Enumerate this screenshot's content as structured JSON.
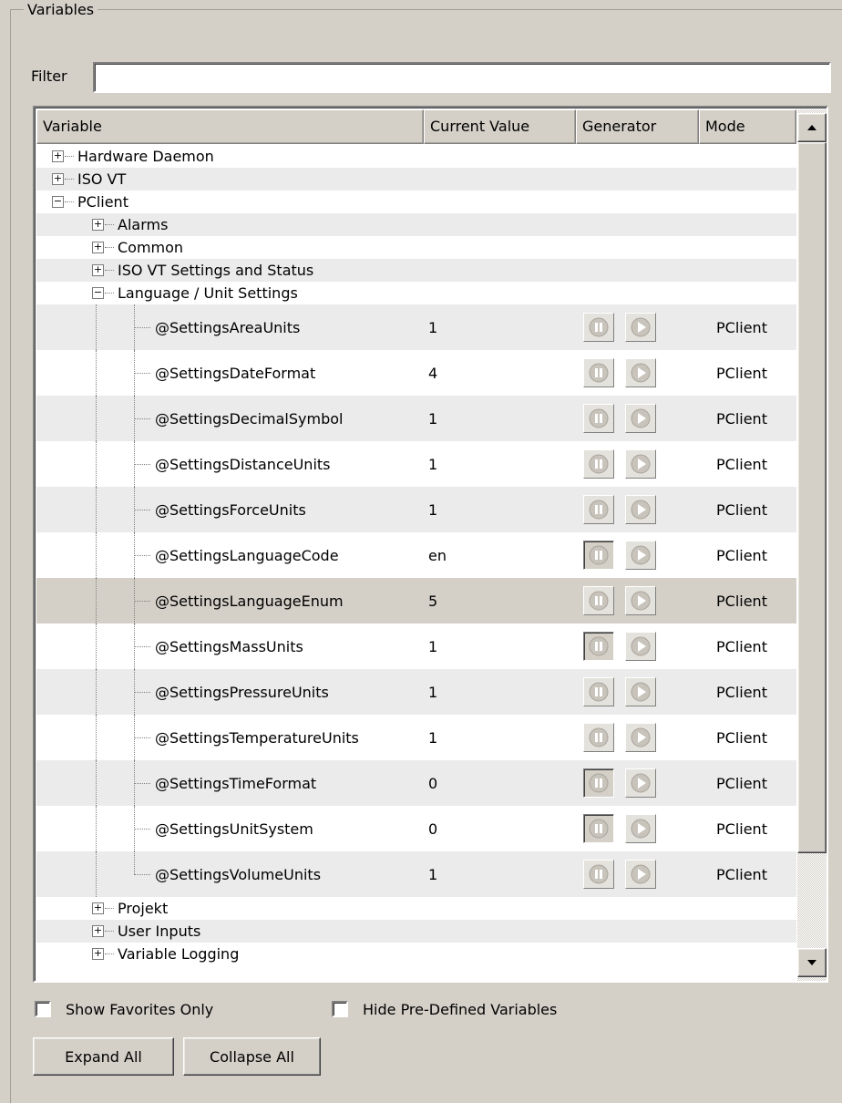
{
  "groupbox_title": "Variables",
  "filter": {
    "label": "Filter",
    "value": ""
  },
  "columns": [
    "Variable",
    "Current Value",
    "Generator",
    "Mode"
  ],
  "tree_top": [
    {
      "label": "Hardware Daemon",
      "expander": "+"
    },
    {
      "label": "ISO VT",
      "expander": "+"
    },
    {
      "label": "PClient",
      "expander": "−"
    }
  ],
  "pclient_children": [
    {
      "label": "Alarms",
      "expander": "+"
    },
    {
      "label": "Common",
      "expander": "+"
    },
    {
      "label": "ISO VT Settings and Status",
      "expander": "+"
    },
    {
      "label": "Language / Unit Settings",
      "expander": "−"
    }
  ],
  "variables": [
    {
      "name": "@SettingsAreaUnits",
      "value": "1",
      "mode": "PClient",
      "pause_pressed": false
    },
    {
      "name": "@SettingsDateFormat",
      "value": "4",
      "mode": "PClient",
      "pause_pressed": false
    },
    {
      "name": "@SettingsDecimalSymbol",
      "value": "1",
      "mode": "PClient",
      "pause_pressed": false
    },
    {
      "name": "@SettingsDistanceUnits",
      "value": "1",
      "mode": "PClient",
      "pause_pressed": false
    },
    {
      "name": "@SettingsForceUnits",
      "value": "1",
      "mode": "PClient",
      "pause_pressed": false
    },
    {
      "name": "@SettingsLanguageCode",
      "value": "en",
      "mode": "PClient",
      "pause_pressed": true
    },
    {
      "name": "@SettingsLanguageEnum",
      "value": "5",
      "mode": "PClient",
      "pause_pressed": false,
      "selected": true
    },
    {
      "name": "@SettingsMassUnits",
      "value": "1",
      "mode": "PClient",
      "pause_pressed": true
    },
    {
      "name": "@SettingsPressureUnits",
      "value": "1",
      "mode": "PClient",
      "pause_pressed": false
    },
    {
      "name": "@SettingsTemperatureUnits",
      "value": "1",
      "mode": "PClient",
      "pause_pressed": false
    },
    {
      "name": "@SettingsTimeFormat",
      "value": "0",
      "mode": "PClient",
      "pause_pressed": true
    },
    {
      "name": "@SettingsUnitSystem",
      "value": "0",
      "mode": "PClient",
      "pause_pressed": true
    },
    {
      "name": "@SettingsVolumeUnits",
      "value": "1",
      "mode": "PClient",
      "pause_pressed": false
    }
  ],
  "tree_bottom": [
    {
      "label": "Projekt",
      "expander": "+"
    },
    {
      "label": "User Inputs",
      "expander": "+"
    },
    {
      "label": "Variable Logging",
      "expander": "+"
    }
  ],
  "options": {
    "show_favorites": {
      "label": "Show Favorites Only",
      "checked": false
    },
    "hide_predefined": {
      "label": "Hide Pre-Defined Variables",
      "checked": false
    }
  },
  "buttons": {
    "expand_all": "Expand All",
    "collapse_all": "Collapse All"
  },
  "icons": {
    "pause": "pause-icon",
    "play": "play-icon",
    "scroll_up": "arrow-up-icon",
    "scroll_down": "arrow-down-icon"
  }
}
